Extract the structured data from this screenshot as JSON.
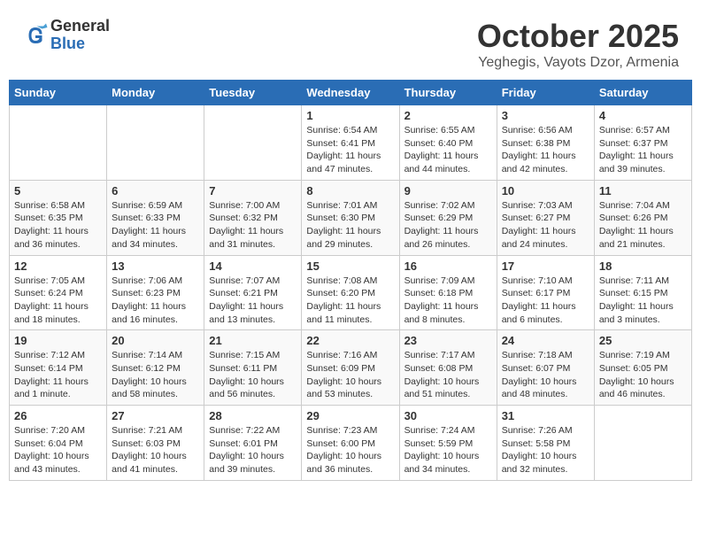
{
  "logo": {
    "general": "General",
    "blue": "Blue"
  },
  "header": {
    "month": "October 2025",
    "location": "Yeghegis, Vayots Dzor, Armenia"
  },
  "days_of_week": [
    "Sunday",
    "Monday",
    "Tuesday",
    "Wednesday",
    "Thursday",
    "Friday",
    "Saturday"
  ],
  "weeks": [
    [
      {
        "day": "",
        "info": ""
      },
      {
        "day": "",
        "info": ""
      },
      {
        "day": "",
        "info": ""
      },
      {
        "day": "1",
        "info": "Sunrise: 6:54 AM\nSunset: 6:41 PM\nDaylight: 11 hours and 47 minutes."
      },
      {
        "day": "2",
        "info": "Sunrise: 6:55 AM\nSunset: 6:40 PM\nDaylight: 11 hours and 44 minutes."
      },
      {
        "day": "3",
        "info": "Sunrise: 6:56 AM\nSunset: 6:38 PM\nDaylight: 11 hours and 42 minutes."
      },
      {
        "day": "4",
        "info": "Sunrise: 6:57 AM\nSunset: 6:37 PM\nDaylight: 11 hours and 39 minutes."
      }
    ],
    [
      {
        "day": "5",
        "info": "Sunrise: 6:58 AM\nSunset: 6:35 PM\nDaylight: 11 hours and 36 minutes."
      },
      {
        "day": "6",
        "info": "Sunrise: 6:59 AM\nSunset: 6:33 PM\nDaylight: 11 hours and 34 minutes."
      },
      {
        "day": "7",
        "info": "Sunrise: 7:00 AM\nSunset: 6:32 PM\nDaylight: 11 hours and 31 minutes."
      },
      {
        "day": "8",
        "info": "Sunrise: 7:01 AM\nSunset: 6:30 PM\nDaylight: 11 hours and 29 minutes."
      },
      {
        "day": "9",
        "info": "Sunrise: 7:02 AM\nSunset: 6:29 PM\nDaylight: 11 hours and 26 minutes."
      },
      {
        "day": "10",
        "info": "Sunrise: 7:03 AM\nSunset: 6:27 PM\nDaylight: 11 hours and 24 minutes."
      },
      {
        "day": "11",
        "info": "Sunrise: 7:04 AM\nSunset: 6:26 PM\nDaylight: 11 hours and 21 minutes."
      }
    ],
    [
      {
        "day": "12",
        "info": "Sunrise: 7:05 AM\nSunset: 6:24 PM\nDaylight: 11 hours and 18 minutes."
      },
      {
        "day": "13",
        "info": "Sunrise: 7:06 AM\nSunset: 6:23 PM\nDaylight: 11 hours and 16 minutes."
      },
      {
        "day": "14",
        "info": "Sunrise: 7:07 AM\nSunset: 6:21 PM\nDaylight: 11 hours and 13 minutes."
      },
      {
        "day": "15",
        "info": "Sunrise: 7:08 AM\nSunset: 6:20 PM\nDaylight: 11 hours and 11 minutes."
      },
      {
        "day": "16",
        "info": "Sunrise: 7:09 AM\nSunset: 6:18 PM\nDaylight: 11 hours and 8 minutes."
      },
      {
        "day": "17",
        "info": "Sunrise: 7:10 AM\nSunset: 6:17 PM\nDaylight: 11 hours and 6 minutes."
      },
      {
        "day": "18",
        "info": "Sunrise: 7:11 AM\nSunset: 6:15 PM\nDaylight: 11 hours and 3 minutes."
      }
    ],
    [
      {
        "day": "19",
        "info": "Sunrise: 7:12 AM\nSunset: 6:14 PM\nDaylight: 11 hours and 1 minute."
      },
      {
        "day": "20",
        "info": "Sunrise: 7:14 AM\nSunset: 6:12 PM\nDaylight: 10 hours and 58 minutes."
      },
      {
        "day": "21",
        "info": "Sunrise: 7:15 AM\nSunset: 6:11 PM\nDaylight: 10 hours and 56 minutes."
      },
      {
        "day": "22",
        "info": "Sunrise: 7:16 AM\nSunset: 6:09 PM\nDaylight: 10 hours and 53 minutes."
      },
      {
        "day": "23",
        "info": "Sunrise: 7:17 AM\nSunset: 6:08 PM\nDaylight: 10 hours and 51 minutes."
      },
      {
        "day": "24",
        "info": "Sunrise: 7:18 AM\nSunset: 6:07 PM\nDaylight: 10 hours and 48 minutes."
      },
      {
        "day": "25",
        "info": "Sunrise: 7:19 AM\nSunset: 6:05 PM\nDaylight: 10 hours and 46 minutes."
      }
    ],
    [
      {
        "day": "26",
        "info": "Sunrise: 7:20 AM\nSunset: 6:04 PM\nDaylight: 10 hours and 43 minutes."
      },
      {
        "day": "27",
        "info": "Sunrise: 7:21 AM\nSunset: 6:03 PM\nDaylight: 10 hours and 41 minutes."
      },
      {
        "day": "28",
        "info": "Sunrise: 7:22 AM\nSunset: 6:01 PM\nDaylight: 10 hours and 39 minutes."
      },
      {
        "day": "29",
        "info": "Sunrise: 7:23 AM\nSunset: 6:00 PM\nDaylight: 10 hours and 36 minutes."
      },
      {
        "day": "30",
        "info": "Sunrise: 7:24 AM\nSunset: 5:59 PM\nDaylight: 10 hours and 34 minutes."
      },
      {
        "day": "31",
        "info": "Sunrise: 7:26 AM\nSunset: 5:58 PM\nDaylight: 10 hours and 32 minutes."
      },
      {
        "day": "",
        "info": ""
      }
    ]
  ]
}
